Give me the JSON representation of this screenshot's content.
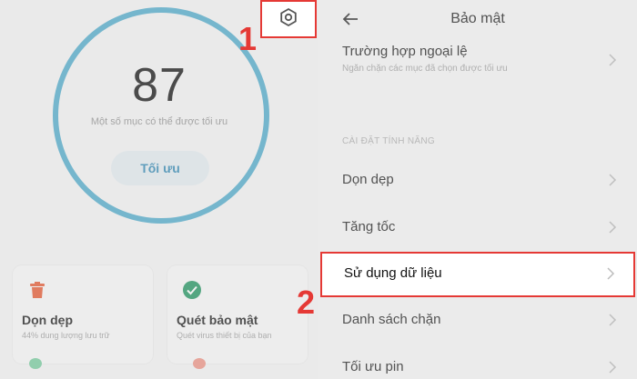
{
  "left": {
    "score": "87",
    "score_subtitle": "Một số mục có thể được tối ưu",
    "optimize_label": "Tối ưu",
    "cards": [
      {
        "title": "Dọn dẹp",
        "desc": "44% dung lượng lưu trữ",
        "icon": "trash-icon",
        "color": "#e8623c"
      },
      {
        "title": "Quét bảo mật",
        "desc": "Quét virus thiết bị của bạn",
        "icon": "shield-check-icon",
        "color": "#2e9b6a"
      }
    ]
  },
  "markers": {
    "step1": "1",
    "step2": "2"
  },
  "right": {
    "title": "Bảo mật",
    "exceptions": {
      "title": "Trường hợp ngoại lệ",
      "desc": "Ngăn chặn các mục đã chọn được tối ưu"
    },
    "section_label": "CÀI ĐẶT TÍNH NĂNG",
    "items": [
      "Dọn dẹp",
      "Tăng tốc",
      "Sử dụng dữ liệu",
      "Danh sách chặn",
      "Tối ưu pin"
    ]
  },
  "colors": {
    "accent": "#3ea4c8",
    "highlight": "#e53935"
  }
}
